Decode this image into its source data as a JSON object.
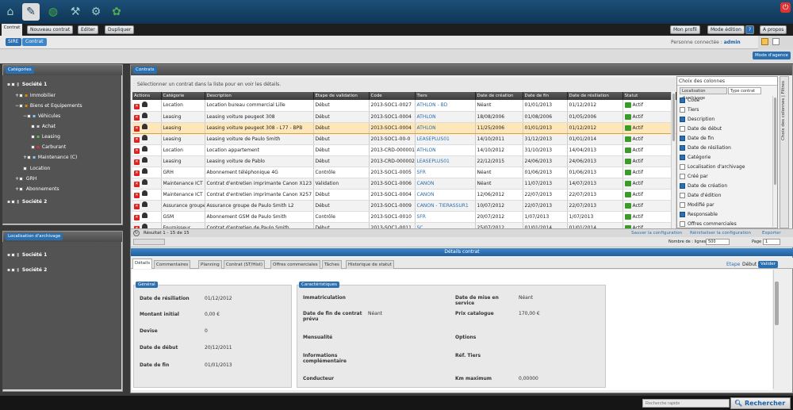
{
  "topbar": {
    "icons": [
      "home-icon",
      "contract-icon",
      "globe-icon",
      "tools-icon",
      "gear-icon",
      "map-icon",
      "power-icon"
    ]
  },
  "menubar": {
    "contrat_tab": "Contrat",
    "new_contract": "Nouveau contrat",
    "edit": "Editer",
    "duplicate": "Dupliquer",
    "mon_profil": "Mon profil",
    "mode_edition": "Mode édition",
    "help": "?",
    "about": "A propos"
  },
  "navbar": {
    "breadcrumb_root": "SIRE",
    "breadcrumb_current": "Contrat",
    "connected_label": "Personne connectée :",
    "connected_user": "admin"
  },
  "subbar": {
    "layout_button": "Mode d'agence"
  },
  "categories": {
    "title": "Catégories",
    "items": [
      {
        "label": "Société 1"
      },
      {
        "label": "Immobilier"
      },
      {
        "label": "Biens et Equipements"
      },
      {
        "label": "Véhicules"
      },
      {
        "label": "Achat"
      },
      {
        "label": "Leasing"
      },
      {
        "label": "Carburant"
      },
      {
        "label": "Maintenance (C)"
      },
      {
        "label": "Location"
      },
      {
        "label": "GRH"
      },
      {
        "label": "Abonnements"
      },
      {
        "label": "Société 2"
      }
    ]
  },
  "archives": {
    "title": "Localisation d'archivage",
    "items": [
      {
        "label": "Société 1"
      },
      {
        "label": "Société 2"
      }
    ]
  },
  "contracts": {
    "title": "Contrats",
    "info": "Sélectionner un contrat dans la liste pour en voir les détails.",
    "columns": [
      "Actions",
      "Catégorie",
      "Description",
      "Etape de validation",
      "Code",
      "Tiers",
      "Date de création",
      "Date de fin",
      "Date de résiliation",
      "Statut"
    ],
    "rows": [
      {
        "cat": "Location",
        "desc": "Location bureau commercial Lille",
        "step": "Début",
        "code": "2013-SOC1-0027",
        "tiers": "ATHLON - BD",
        "created": "Néant",
        "end": "01/01/2013",
        "resil": "01/12/2012",
        "status": "Actif"
      },
      {
        "cat": "Leasing",
        "desc": "Leasing voiture peugeot 308",
        "step": "Début",
        "code": "2013-SOC1-0004",
        "tiers": "ATHLON",
        "created": "18/08/2006",
        "end": "01/08/2006",
        "resil": "01/05/2006",
        "status": "Actif"
      },
      {
        "cat": "Leasing",
        "desc": "Leasing voiture peugeot 308 - L77 - BPB",
        "step": "Début",
        "code": "2013-SOC1-0004",
        "tiers": "ATHLON",
        "created": "11/25/2006",
        "end": "01/01/2013",
        "resil": "01/12/2012",
        "status": "Actif"
      },
      {
        "cat": "Leasing",
        "desc": "Leasing voiture de Paulo Smith",
        "step": "Début",
        "code": "2013-SOC1-00-0",
        "tiers": "LEASEPLUS01",
        "created": "14/10/2011",
        "end": "31/12/2013",
        "resil": "01/01/2014",
        "status": "Actif"
      },
      {
        "cat": "Location",
        "desc": "Location appartement",
        "step": "Début",
        "code": "2013-CRD-000001",
        "tiers": "ATHLON",
        "created": "14/10/2012",
        "end": "31/10/2013",
        "resil": "14/04/2013",
        "status": "Actif"
      },
      {
        "cat": "Leasing",
        "desc": "Leasing voiture de Pablo",
        "step": "Début",
        "code": "2013-CRD-000002",
        "tiers": "LEASEPLUS01",
        "created": "22/12/2015",
        "end": "24/06/2013",
        "resil": "24/06/2013",
        "status": "Actif"
      },
      {
        "cat": "GRH",
        "desc": "Abonnement téléphonique 4G",
        "step": "Contrôle",
        "code": "2013-SOC1-0005",
        "tiers": "SFR",
        "created": "Néant",
        "end": "01/06/2013",
        "resil": "01/06/2013",
        "status": "Actif"
      },
      {
        "cat": "Maintenance ICT",
        "desc": "Contrat d'entretien imprimante Canon X123",
        "step": "Validation",
        "code": "2013-SOC1-0006",
        "tiers": "CANON",
        "created": "Néant",
        "end": "11/07/2013",
        "resil": "14/07/2013",
        "status": "Actif"
      },
      {
        "cat": "Maintenance ICT",
        "desc": "Contrat d'entretien imprimante Canon X257",
        "step": "Début",
        "code": "2013-SOC1-0004",
        "tiers": "CANON",
        "created": "12/06/2012",
        "end": "22/07/2013",
        "resil": "22/07/2013",
        "status": "Actif"
      },
      {
        "cat": "Assurance groupe",
        "desc": "Assurance groupe de Paulo Smith L2",
        "step": "Début",
        "code": "2013-SOC1-0009",
        "tiers": "CANON - TIERASSUR1",
        "created": "10/07/2012",
        "end": "22/07/2013",
        "resil": "22/07/2013",
        "status": "Actif"
      },
      {
        "cat": "GSM",
        "desc": "Abonnement GSM de Paulo Smith",
        "step": "Contrôle",
        "code": "2013-SOC1-0010",
        "tiers": "SFR",
        "created": "20/07/2012",
        "end": "1/07/2013",
        "resil": "1/07/2013",
        "status": "Actif"
      },
      {
        "cat": "Fournisseur",
        "desc": "Contrat d'entretien de Paulo Smith",
        "step": "Début",
        "code": "2013-SOC1-0011",
        "tiers": "SC",
        "created": "25/07/2012",
        "end": "01/01/2014",
        "resil": "01/01/2014",
        "status": "Actif"
      }
    ],
    "footer_count": "Résultat 1 - 15 de 15",
    "save_config": "Sauver la configuration",
    "reset_config": "Réinitialiser la configuration",
    "export": "Exporter",
    "rows_label": "Nombre de : lignes",
    "rows_value": "500",
    "page_label": "Page",
    "page_value": "1"
  },
  "columns_chooser": {
    "title": "Choix des colonnes",
    "tab1": "Localisation d'archivage",
    "tab2": "Type contrat",
    "side_label": "Choix des colonnes | Filtres",
    "items": [
      {
        "label": "Code",
        "on": true
      },
      {
        "label": "Tiers",
        "on": false
      },
      {
        "label": "Description",
        "on": true
      },
      {
        "label": "Date de début",
        "on": false
      },
      {
        "label": "Date de fin",
        "on": true
      },
      {
        "label": "Date de résiliation",
        "on": true
      },
      {
        "label": "Catégorie",
        "on": true
      },
      {
        "label": "Localisation d'archivage",
        "on": false
      },
      {
        "label": "Créé par",
        "on": false
      },
      {
        "label": "Date de création",
        "on": true
      },
      {
        "label": "Date d'édition",
        "on": false
      },
      {
        "label": "Modifié par",
        "on": false
      },
      {
        "label": "Responsable",
        "on": true
      },
      {
        "label": "Offres commerciales",
        "on": false
      }
    ]
  },
  "details": {
    "header": "Détails contrat",
    "tabs": [
      "Détails",
      "Commentaires",
      "Planning",
      "Contrat (ST/Hist)",
      "Offres commerciales",
      "Tâches",
      "Historique de statut"
    ],
    "actions": {
      "step1": "Etape",
      "step2": "Début",
      "validate": "Valider"
    },
    "general_title": "Général",
    "characteristics_title": "Caractéristiques",
    "general": [
      {
        "label": "Date de résiliation",
        "value": "01/12/2012"
      },
      {
        "label": "Montant initial",
        "value": "0,00 €"
      },
      {
        "label": "Devise",
        "value": "0"
      },
      {
        "label": "Date de début",
        "value": "20/12/2011"
      },
      {
        "label": "Date de fin",
        "value": "01/01/2013"
      }
    ],
    "char_left": [
      {
        "label": "Immatriculation",
        "value": ""
      },
      {
        "label": "Date de fin de contrat prévu",
        "value": "Néant"
      },
      {
        "label": "Mensualité",
        "value": ""
      },
      {
        "label": "Informations complémentaire",
        "value": ""
      },
      {
        "label": "Conducteur",
        "value": ""
      }
    ],
    "char_right": [
      {
        "label": "Date de mise en service",
        "value": "Néant"
      },
      {
        "label": "Prix catalogue",
        "value": "170,00 €"
      },
      {
        "label": "Options",
        "value": ""
      },
      {
        "label": "Réf. Tiers",
        "value": ""
      },
      {
        "label": "Km maximum",
        "value": "0,00000"
      }
    ]
  },
  "bottom": {
    "search_placeholder": "Recherche rapide",
    "search_button": "Rechercher"
  }
}
